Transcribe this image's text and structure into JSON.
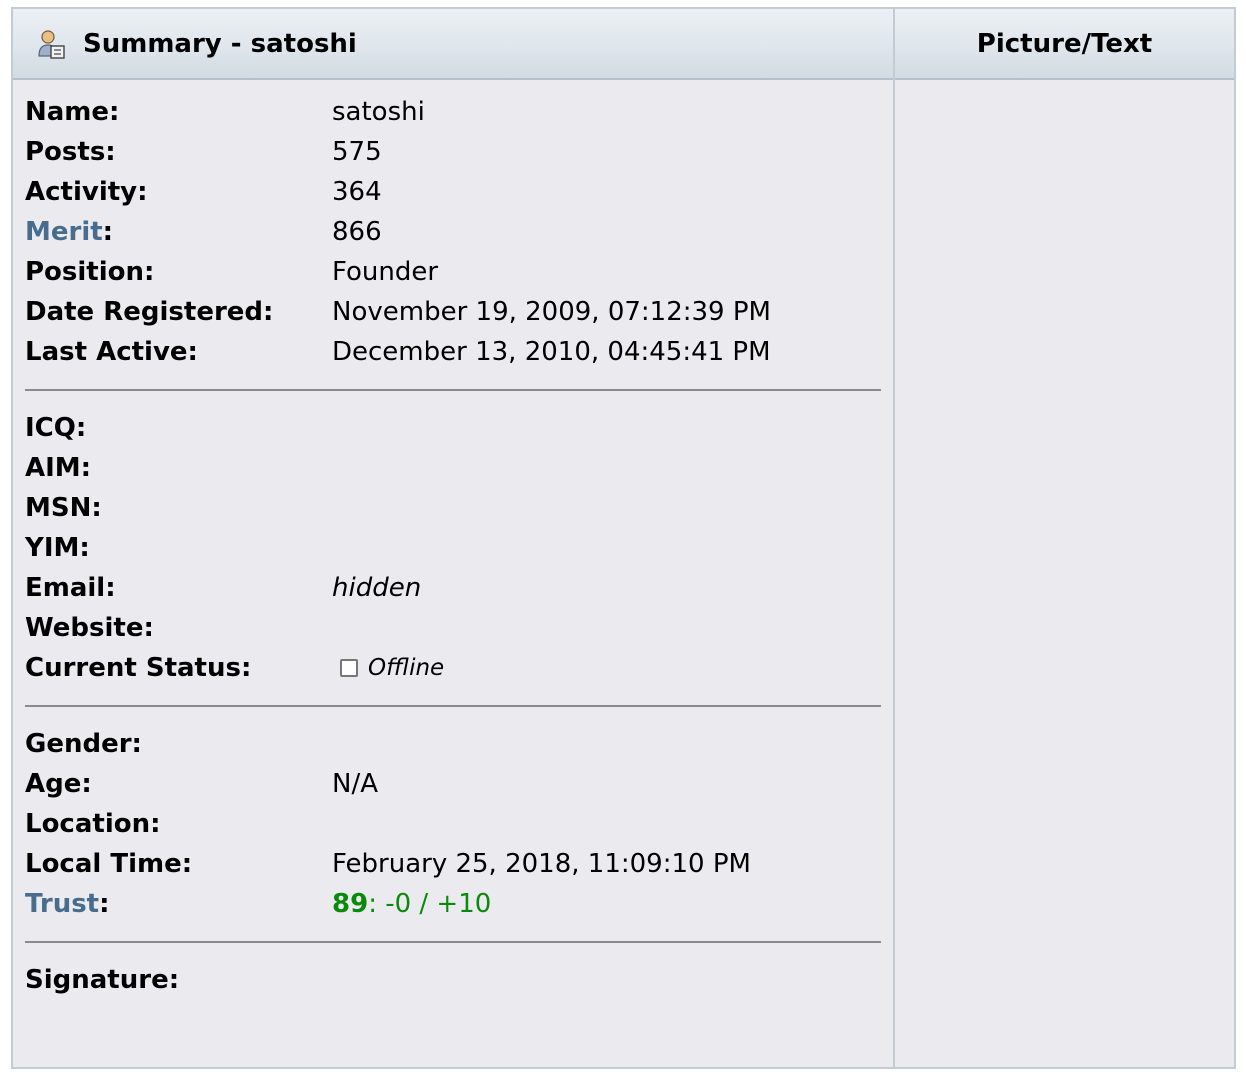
{
  "header": {
    "summary_title": "Summary - satoshi",
    "picture_title": "Picture/Text"
  },
  "group1": [
    {
      "label": "Name:",
      "value": "satoshi"
    },
    {
      "label": "Posts:",
      "value": "575"
    },
    {
      "label": "Activity:",
      "value": "364"
    },
    {
      "label_link": "Merit",
      "label_suffix": ":",
      "value": "866"
    },
    {
      "label": "Position:",
      "value": "Founder"
    },
    {
      "label": "Date Registered:",
      "value": "November 19, 2009, 07:12:39 PM"
    },
    {
      "label": "Last Active:",
      "value": "December 13, 2010, 04:45:41 PM"
    }
  ],
  "group2": [
    {
      "label": "ICQ:",
      "value": ""
    },
    {
      "label": "AIM:",
      "value": ""
    },
    {
      "label": "MSN:",
      "value": ""
    },
    {
      "label": "YIM:",
      "value": ""
    },
    {
      "label": "Email:",
      "value": "hidden"
    },
    {
      "label": "Website:",
      "value": ""
    },
    {
      "label": "Current Status:",
      "value": "Offline"
    }
  ],
  "group3": [
    {
      "label": "Gender:",
      "value": ""
    },
    {
      "label": "Age:",
      "value": "N/A"
    },
    {
      "label": "Location:",
      "value": ""
    },
    {
      "label": "Local Time:",
      "value": "February 25, 2018, 11:09:10 PM"
    },
    {
      "label_link": "Trust",
      "label_suffix": ":",
      "trust_score": "89",
      "trust_detail": ": -0 / +10"
    }
  ],
  "group4": [
    {
      "label": "Signature:",
      "value": ""
    }
  ],
  "colors": {
    "link": "#476c8e",
    "trust": "#0a8a0a"
  },
  "icons": {
    "header_icon": "user-profile-icon",
    "status_icon": "offline-checkbox-icon"
  }
}
